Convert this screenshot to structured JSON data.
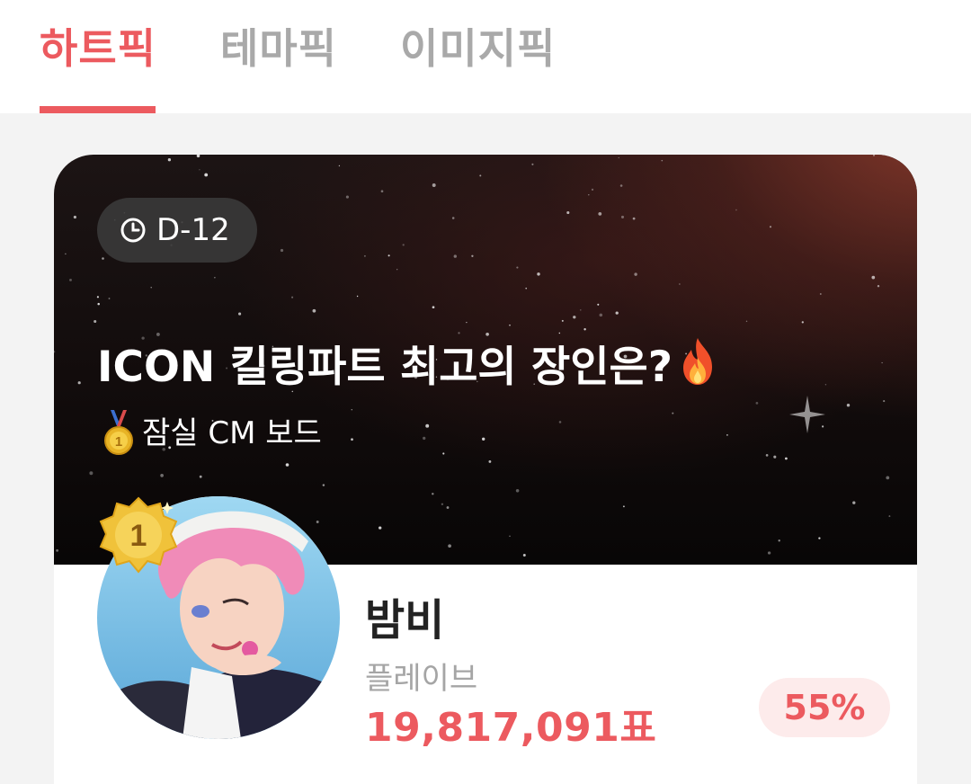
{
  "tabs": [
    {
      "label": "하트픽",
      "active": true
    },
    {
      "label": "테마픽",
      "active": false
    },
    {
      "label": "이미지픽",
      "active": false
    }
  ],
  "colors": {
    "accent": "#ec5a5f",
    "tab_inactive": "#a9a9a9",
    "badge_bg": "#fdebeb"
  },
  "event": {
    "dday": "D-12",
    "dday_icon": "clock-icon",
    "title": "ICON 킬링파트 최고의 장인은?",
    "title_icon": "fire-icon",
    "subtitle": "잠실 CM 보드",
    "subtitle_icon": "gold-medal-icon"
  },
  "leader": {
    "rank": "1",
    "name": "밤비",
    "agency": "플레이브",
    "votes": "19,817,091표",
    "percent": "55%"
  }
}
